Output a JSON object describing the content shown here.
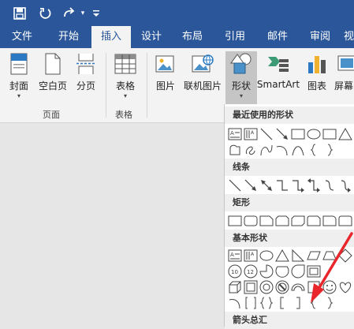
{
  "qat": {
    "save_icon": "save-icon",
    "undo_icon": "undo-icon",
    "redo_icon": "redo-icon",
    "customize_icon": "customize-qat-icon"
  },
  "tabs": [
    "文件",
    "开始",
    "插入",
    "设计",
    "布局",
    "引用",
    "邮件",
    "审阅",
    "视"
  ],
  "active_tab": "插入",
  "ribbon": {
    "pages_group": {
      "label": "页面",
      "cover": "封面",
      "blank": "空白页",
      "break": "分页"
    },
    "tables_group": {
      "label": "表格",
      "table": "表格"
    },
    "illustrations": {
      "picture": "图片",
      "online_picture": "联机图片",
      "shapes": "形状",
      "smartart": "SmartArt",
      "chart": "图表",
      "screenshot": "屏幕"
    }
  },
  "shapes_panel": {
    "sections": {
      "recent": "最近使用的形状",
      "lines": "线条",
      "rectangles": "矩形",
      "basic": "基本形状",
      "arrows": "箭头总汇"
    }
  },
  "colors": {
    "ribbon_blue": "#2b579a",
    "annotation_red": "#e8262b"
  }
}
